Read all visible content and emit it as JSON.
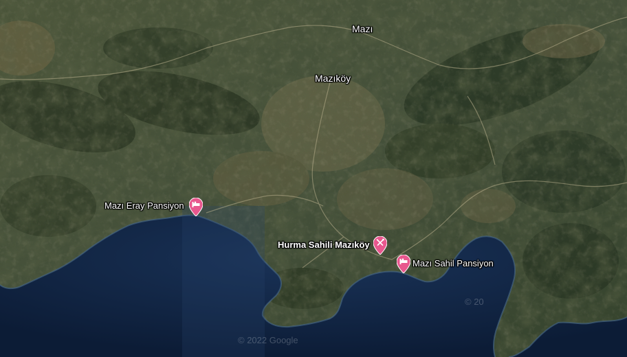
{
  "map": {
    "type": "satellite",
    "places": [
      {
        "id": "mazi",
        "name": "Mazı"
      },
      {
        "id": "mazikoy",
        "name": "Mazıköy"
      }
    ],
    "pois": [
      {
        "id": "eray",
        "name": "Mazı Eray Pansiyon",
        "icon": "bed-icon",
        "color": "#e8578e"
      },
      {
        "id": "hurma",
        "name": "Hurma Sahili Mazıköy",
        "icon": "restaurant-icon",
        "color": "#e8578e"
      },
      {
        "id": "sahil",
        "name": "Mazı Sahil Pansiyon",
        "icon": "bed-icon",
        "color": "#e8578e"
      }
    ],
    "watermarks": {
      "main": "© 2022 Google",
      "secondary": "© 20"
    },
    "colors": {
      "sea": "#0f2240",
      "land": "#3d4a30"
    }
  }
}
